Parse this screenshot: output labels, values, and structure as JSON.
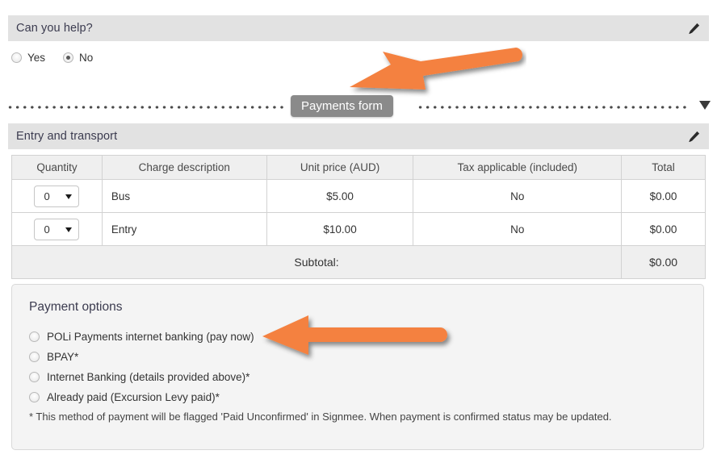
{
  "colors": {
    "section_bar": "#e2e2e2",
    "accent_arrow": "#F4813F",
    "divider_pill": "#8a8a8a",
    "panel_bg": "#f4f4f4"
  },
  "help_section": {
    "title": "Can you help?",
    "edit_icon": "pencil-icon",
    "options": [
      {
        "label": "Yes",
        "checked": false
      },
      {
        "label": "No",
        "checked": true
      }
    ]
  },
  "divider": {
    "label": "Payments form",
    "caret_icon": "triangle-down-icon"
  },
  "entry_section": {
    "title": "Entry and transport",
    "edit_icon": "pencil-icon"
  },
  "charges_table": {
    "headers": [
      "Quantity",
      "Charge description",
      "Unit price (AUD)",
      "Tax applicable (included)",
      "Total"
    ],
    "rows": [
      {
        "quantity": "0",
        "description": "Bus",
        "unit_price": "$5.00",
        "tax": "No",
        "total": "$0.00"
      },
      {
        "quantity": "0",
        "description": "Entry",
        "unit_price": "$10.00",
        "tax": "No",
        "total": "$0.00"
      }
    ],
    "subtotal_label": "Subtotal:",
    "subtotal_value": "$0.00"
  },
  "payment_options": {
    "title": "Payment options",
    "options": [
      {
        "label": "POLi Payments internet banking (pay now)",
        "checked": false
      },
      {
        "label": "BPAY*",
        "checked": false
      },
      {
        "label": "Internet Banking (details provided above)*",
        "checked": false
      },
      {
        "label": "Already paid (Excursion Levy paid)*",
        "checked": false
      }
    ],
    "note": "* This method of payment will be flagged 'Paid Unconfirmed' in Signmee. When payment is confirmed status may be updated."
  },
  "annotations": [
    {
      "name": "arrow-pointing-to-payments-form",
      "direction": "left"
    },
    {
      "name": "arrow-pointing-to-poli-option",
      "direction": "left"
    }
  ]
}
